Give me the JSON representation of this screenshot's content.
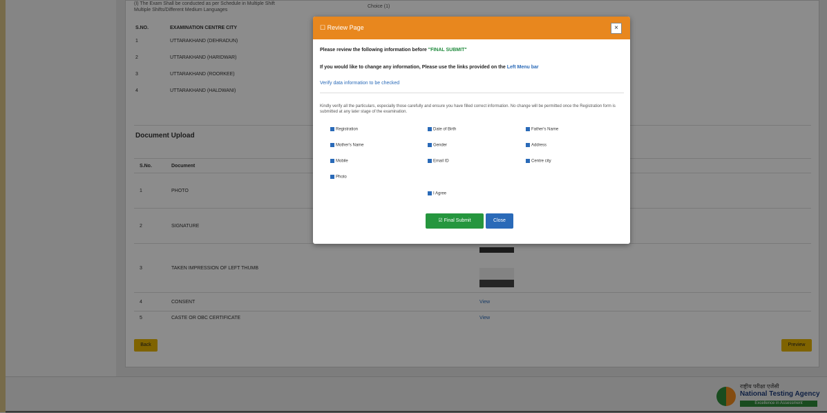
{
  "background": {
    "top_text_1": "(I) The Exam Shall be conducted as per Schedule in Multiple Shift",
    "top_text_2": "Multiple Shifts/Different Medium Languages",
    "top_text_right": "Choice (1)",
    "centres_table": {
      "headers": [
        "S.NO.",
        "EXAMINATION CENTRE CITY"
      ],
      "rows": [
        [
          "1",
          "UTTARAKHAND (DEHRADUN)"
        ],
        [
          "2",
          "UTTARAKHAND (HARIDWAR)"
        ],
        [
          "3",
          "UTTARAKHAND (ROORKEE)"
        ],
        [
          "4",
          "UTTARAKHAND (HALDWANI)"
        ]
      ]
    },
    "documents_section_title": "Document Upload",
    "documents_table": {
      "headers": [
        "S.No.",
        "Document"
      ],
      "rows": [
        {
          "sno": "1",
          "name": "PHOTO",
          "view": ""
        },
        {
          "sno": "2",
          "name": "SIGNATURE",
          "view": ""
        },
        {
          "sno": "3",
          "name": "TAKEN IMPRESSION OF LEFT THUMB",
          "view": ""
        },
        {
          "sno": "4",
          "name": "CONSENT",
          "view": "View"
        },
        {
          "sno": "5",
          "name": "CASTE OR OBC CERTIFICATE",
          "view": "View"
        }
      ]
    },
    "back_label": "Back",
    "preview_label": "Preview",
    "footer": {
      "hindi": "राष्ट्रीय परीक्षा एजेंसी",
      "english": "National Testing Agency",
      "tagline": "Excellence in Assessment",
      "colors": {
        "saffron": "#f08a1e",
        "green": "#2e8b3a",
        "navy": "#1d3b7a"
      }
    }
  },
  "modal": {
    "title": "Review Page",
    "line1_prefix": "Please review the following information before ",
    "line1_highlight": "\"FINAL SUBMIT\"",
    "line2_prefix": "If you would like to change any information, Please use the links provided on the ",
    "line2_link": "Left Menu bar",
    "line3": "Verify data information to be checked",
    "note": "Kindly verify all the particulars, especially those carefully and ensure you have filled correct information. No change will be permitted once the Registration form is submitted at any later stage of the examination.",
    "checkboxes": [
      "Registration",
      "Date of Birth",
      "Father's Name",
      "Mother's Name",
      "Gender",
      "Address",
      "Mobile",
      "Email ID",
      "Centre city",
      "Photo",
      "I Agree"
    ],
    "final_submit_label": "Final Submit",
    "close_label": "Close",
    "colors": {
      "header": "#e8871e",
      "final": "#25963e",
      "close": "#2a6ab8"
    }
  }
}
